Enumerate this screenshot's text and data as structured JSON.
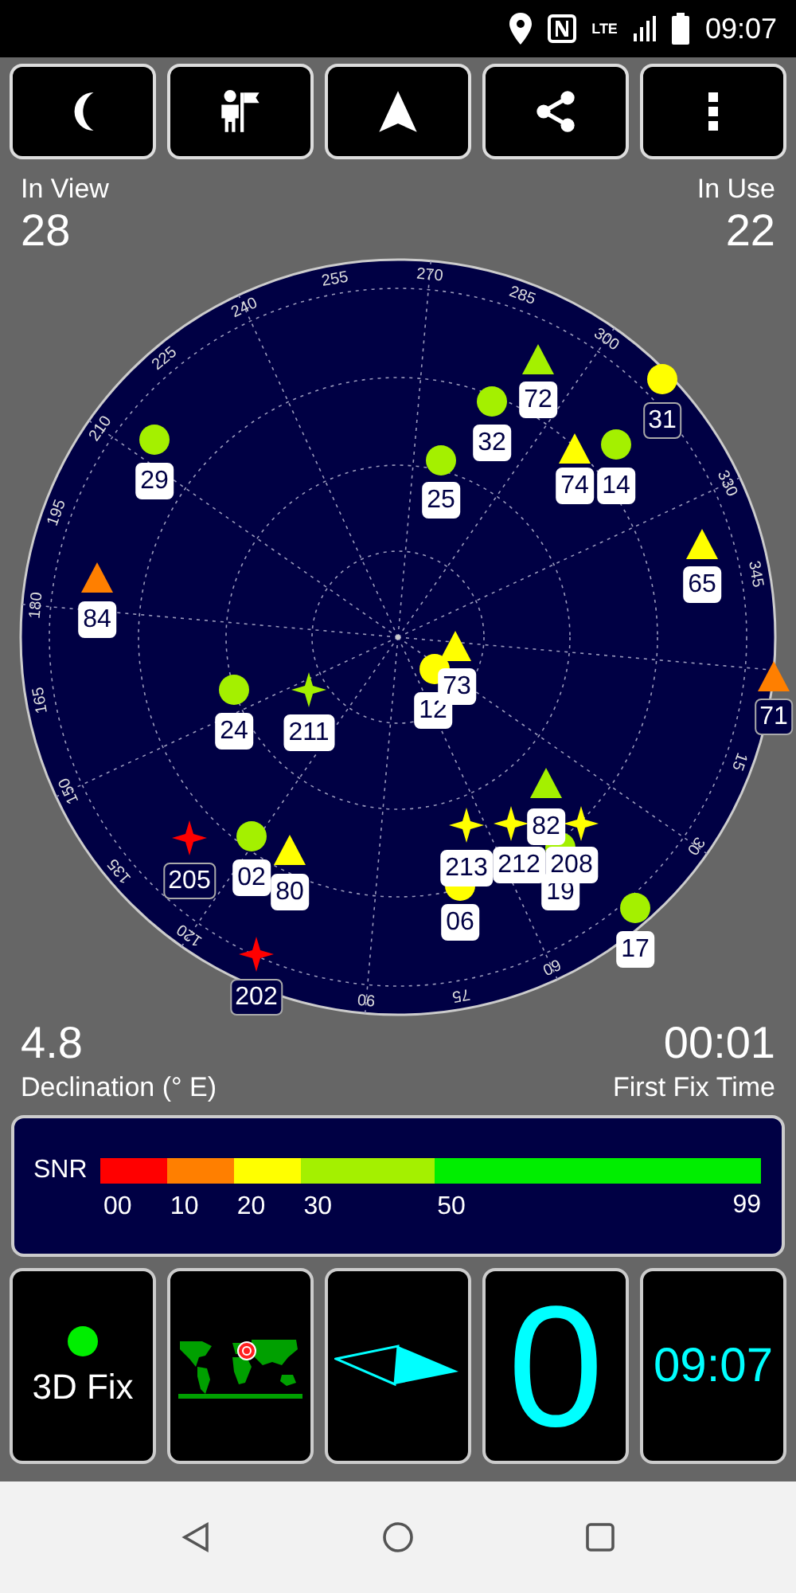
{
  "status_bar": {
    "network": "LTE",
    "time": "09:07"
  },
  "stats": {
    "in_view_label": "In View",
    "in_view": "28",
    "in_use_label": "In Use",
    "in_use": "22"
  },
  "sky_plot": {
    "azimuth_labels": [
      "255",
      "270",
      "285",
      "300",
      "330",
      "345",
      "15",
      "30",
      "60",
      "75",
      "90",
      "120",
      "135",
      "150",
      "165",
      "180",
      "195",
      "210",
      "225",
      "240"
    ],
    "satellites": [
      {
        "id": "72",
        "kind": "triangle",
        "color": "#a4f000",
        "in_use": true
      },
      {
        "id": "32",
        "kind": "circle",
        "color": "#a4f000",
        "in_use": true
      },
      {
        "id": "31",
        "kind": "circle",
        "color": "#ffff00",
        "in_use": false
      },
      {
        "id": "29",
        "kind": "circle",
        "color": "#a4f000",
        "in_use": true
      },
      {
        "id": "25",
        "kind": "circle",
        "color": "#a4f000",
        "in_use": true
      },
      {
        "id": "74",
        "kind": "triangle",
        "color": "#ffff00",
        "in_use": true
      },
      {
        "id": "14",
        "kind": "circle",
        "color": "#a4f000",
        "in_use": true
      },
      {
        "id": "65",
        "kind": "triangle",
        "color": "#ffff00",
        "in_use": true
      },
      {
        "id": "84",
        "kind": "triangle",
        "color": "#ff7f00",
        "in_use": true
      },
      {
        "id": "12",
        "kind": "circle",
        "color": "#ffff00",
        "in_use": true
      },
      {
        "id": "73",
        "kind": "triangle",
        "color": "#ffff00",
        "in_use": true
      },
      {
        "id": "71",
        "kind": "triangle",
        "color": "#ff7f00",
        "in_use": false
      },
      {
        "id": "24",
        "kind": "circle",
        "color": "#a4f000",
        "in_use": true
      },
      {
        "id": "211",
        "kind": "star",
        "color": "#a4f000",
        "in_use": true
      },
      {
        "id": "82",
        "kind": "triangle",
        "color": "#a4f000",
        "in_use": true
      },
      {
        "id": "213",
        "kind": "star",
        "color": "#ffff00",
        "in_use": true
      },
      {
        "id": "06",
        "kind": "circle",
        "color": "#ffff00",
        "in_use": true
      },
      {
        "id": "19",
        "kind": "circle",
        "color": "#a4f000",
        "in_use": true
      },
      {
        "id": "212",
        "kind": "star",
        "color": "#ffff00",
        "in_use": true
      },
      {
        "id": "208",
        "kind": "star",
        "color": "#ffff00",
        "in_use": true
      },
      {
        "id": "17",
        "kind": "circle",
        "color": "#a4f000",
        "in_use": true
      },
      {
        "id": "205",
        "kind": "star",
        "color": "#ff0000",
        "in_use": false
      },
      {
        "id": "02",
        "kind": "circle",
        "color": "#a4f000",
        "in_use": true
      },
      {
        "id": "80",
        "kind": "triangle",
        "color": "#ffff00",
        "in_use": true
      },
      {
        "id": "202",
        "kind": "star",
        "color": "#ff0000",
        "in_use": false
      }
    ]
  },
  "footer": {
    "declination": "4.8",
    "declination_label": "Declination (° E)",
    "ttff": "00:01",
    "ttff_label": "First Fix Time"
  },
  "snr": {
    "label": "SNR",
    "segments": [
      {
        "label": "00",
        "color": "#ff0000"
      },
      {
        "label": "10",
        "color": "#ff7f00"
      },
      {
        "label": "20",
        "color": "#ffff00"
      },
      {
        "label": "30",
        "color": "#a4f000"
      },
      {
        "label": "50",
        "color": "#00ee00"
      }
    ],
    "max_label": "99"
  },
  "tiles": {
    "fix": {
      "label": "3D Fix",
      "has_fix": true
    },
    "speed": "0",
    "clock": "09:07"
  }
}
